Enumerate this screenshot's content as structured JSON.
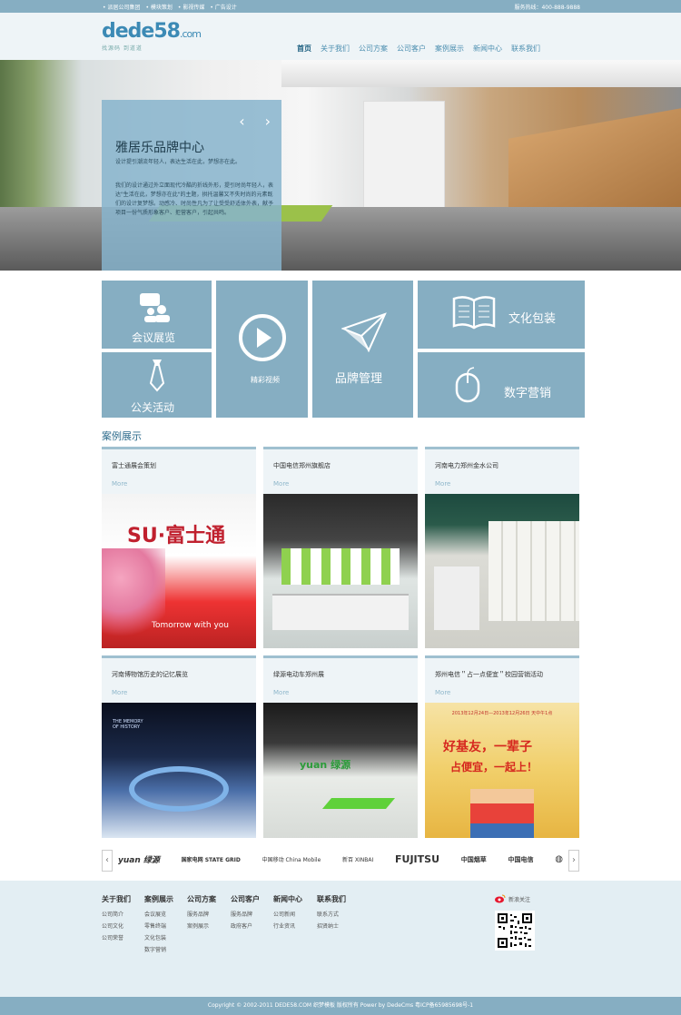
{
  "topbar": {
    "links": [
      "• 派居公司集团",
      "• 模块策划",
      "• 影视传媒",
      "• 广告设计"
    ],
    "hotline": "服务热线：400-888-9888"
  },
  "logo": {
    "main": "dede58",
    "suffix": ".com",
    "slogan": "找源码 到道道"
  },
  "nav": [
    "首页",
    "关于我们",
    "公司方案",
    "公司客户",
    "案例展示",
    "新闻中心",
    "联系我们"
  ],
  "banner": {
    "title": "雅居乐品牌中心",
    "subtitle": "设计提引潮流年轻人，表达生活在此，梦想亦在此。",
    "description": "我们的设计通过外立面现代冷酷的折线外形，提引时尚年轻人，表达\"生活在此，梦想亦在此\"的主题，拱托温馨又不失时尚的元素既们的设计复梦想。动感冷、时尚性凡为了让受受舒适体外表，献予项目一份气质形象客户、拒营客户，引起共鸣。",
    "prev": "‹",
    "next": "›"
  },
  "tiles": {
    "meeting": "会议展览",
    "video": "精彩视频",
    "brand": "品牌管理",
    "culture": "文化包装",
    "pr": "公关活动",
    "digital": "数字营销"
  },
  "section_title": "案例展示",
  "cases": [
    {
      "title": "富士通展会策划",
      "more": "More"
    },
    {
      "title": "中国电信郑州旗舰店",
      "more": "More"
    },
    {
      "title": "河南电力郑州金水公司",
      "more": "More"
    },
    {
      "title": "河南博物馆历史的记忆展览",
      "more": "More"
    },
    {
      "title": "绿源电动车郑州展",
      "more": "More"
    },
    {
      "title": "郑州电信＂占一点便宜＂校园营销活动",
      "more": "More"
    }
  ],
  "case_image_text": {
    "fujitsu": "SU·富士通",
    "tomorrow": "Tomorrow with you",
    "history": "THE MEMORY OF HISTORY",
    "yuan": "yuan 绿源",
    "promo_top": "2013年12月24日—2013年12月26日 天中午1点",
    "promo_main": "好基友，一辈子",
    "promo_sub": "占便宜，一起上！"
  },
  "partners": {
    "prev": "‹",
    "next": "›",
    "logos": [
      "yuan 绿源",
      "国家电网 STATE GRID",
      "中国移动 China Mobile",
      "新百 XINBAI",
      "FUJITSU",
      "中国烟草",
      "中国电信",
      "◍"
    ]
  },
  "footer": {
    "columns": [
      {
        "title": "关于我们",
        "items": [
          "公司简介",
          "公司文化",
          "公司荣誉"
        ]
      },
      {
        "title": "案例展示",
        "items": [
          "会议展览",
          "零售终端",
          "文化包装",
          "数字营销"
        ]
      },
      {
        "title": "公司方案",
        "items": [
          "服务品牌",
          "案例展示"
        ]
      },
      {
        "title": "公司客户",
        "items": [
          "服务品牌",
          "政府客户"
        ]
      },
      {
        "title": "新闻中心",
        "items": [
          "公司新闻",
          "行业资讯"
        ]
      },
      {
        "title": "联系我们",
        "items": [
          "联系方式",
          "招贤纳士"
        ]
      }
    ],
    "weibo": "新浪关注",
    "copyright": "Copyright © 2002-2011 DEDE58.COM 织梦模板 版权所有  Power by DedeCms    粤ICP备65985698号-1"
  },
  "colors": {
    "accent": "#86aec2",
    "nav_text": "#4d8fb0",
    "footer_bg": "#e3eef3"
  }
}
